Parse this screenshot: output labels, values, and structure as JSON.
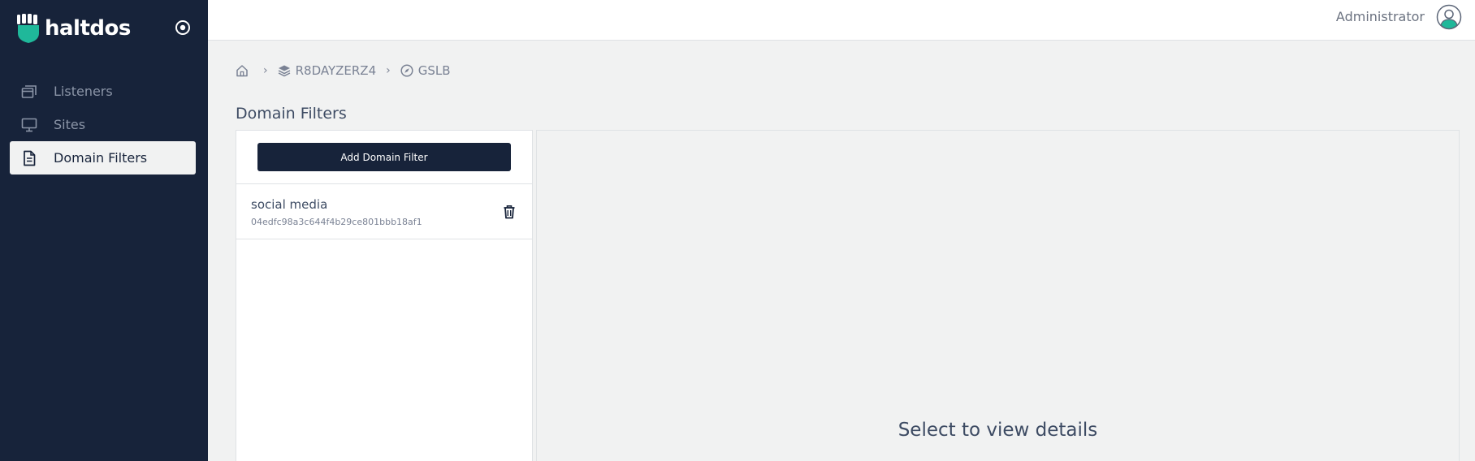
{
  "app": {
    "logo_text": "haltdos"
  },
  "sidebar": {
    "items": [
      {
        "label": "Listeners",
        "icon": "windows-icon"
      },
      {
        "label": "Sites",
        "icon": "monitor-icon"
      },
      {
        "label": "Domain Filters",
        "icon": "document-icon",
        "active": true
      }
    ]
  },
  "header": {
    "user_name": "Administrator"
  },
  "breadcrumb": {
    "items": [
      {
        "label": "",
        "icon": "home-icon"
      },
      {
        "label": "R8DAYZERZ4",
        "icon": "layers-icon"
      },
      {
        "label": "GSLB",
        "icon": "compass-icon"
      }
    ]
  },
  "main": {
    "title": "Domain Filters",
    "add_button_label": "Add Domain Filter",
    "filters": [
      {
        "name": "social media",
        "id": "04edfc98a3c644f4b29ce801bbb18af1"
      }
    ],
    "empty_detail_text": "Select to view details"
  },
  "colors": {
    "sidebar_bg": "#17233a",
    "brand_accent": "#1fb89a",
    "button_bg": "#17233a",
    "page_bg": "#f1f2f2"
  }
}
